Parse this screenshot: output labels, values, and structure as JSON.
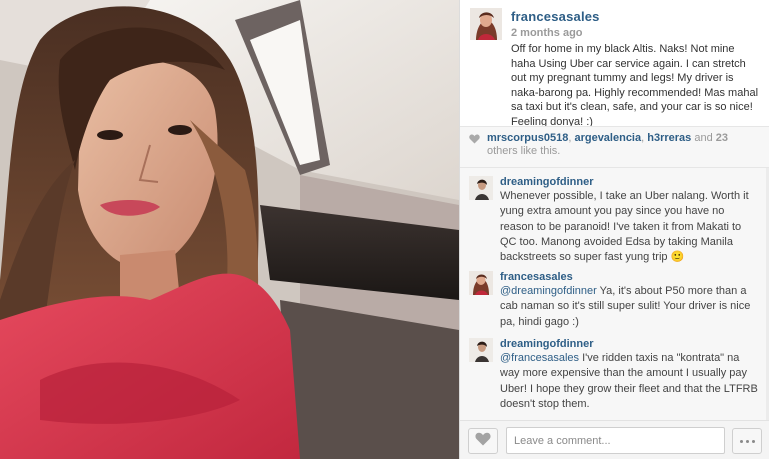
{
  "post": {
    "photo_subject": "woman in red selfie in car",
    "owner": {
      "username": "francesasales",
      "time_ago": "2 months ago",
      "caption": "Off for home in my black Altis. Naks! Not mine haha Using Uber car service again. I can stretch out my pregnant tummy and legs! My driver is naka-barong pa. Highly recommended! Mas mahal sa taxi but it's clean, safe, and your car is so nice! Feeling donya! :)"
    },
    "likes": {
      "users": [
        "mrscorpus0518",
        "argevalencia",
        "h3rreras"
      ],
      "separator": ", ",
      "and_text": " and ",
      "others_count": "23",
      "others_text": " others like this."
    },
    "comments": [
      {
        "username": "dreamingofdinner",
        "mention": "",
        "text": "Whenever possible, I take an Uber nalang. Worth it yung extra amount you pay since you have no reason to be paranoid! I've taken it from Makati to QC too. Manong avoided Edsa by taking Manila backstreets so super fast yung trip 🙂"
      },
      {
        "username": "francesasales",
        "mention": "@dreamingofdinner",
        "text": " Ya, it's about P50 more than a cab naman so it's still super sulit! Your driver is nice pa, hindi gago :)"
      },
      {
        "username": "dreamingofdinner",
        "mention": "@francesasales",
        "text": " I've ridden taxis na \"kontrata\" na way more expensive than the amount I usually pay Uber! I hope they grow their fleet and that the LTFRB doesn't stop them."
      }
    ],
    "comment_input": {
      "placeholder": "Leave a comment...",
      "value": ""
    },
    "icons": {
      "like_button": "heart-icon",
      "likes_row": "heart-icon",
      "more_button": "ellipsis-icon"
    }
  },
  "colors": {
    "username": "#2e5e86",
    "muted": "#9a9a9a",
    "panel_bg": "#f7f7f7"
  }
}
